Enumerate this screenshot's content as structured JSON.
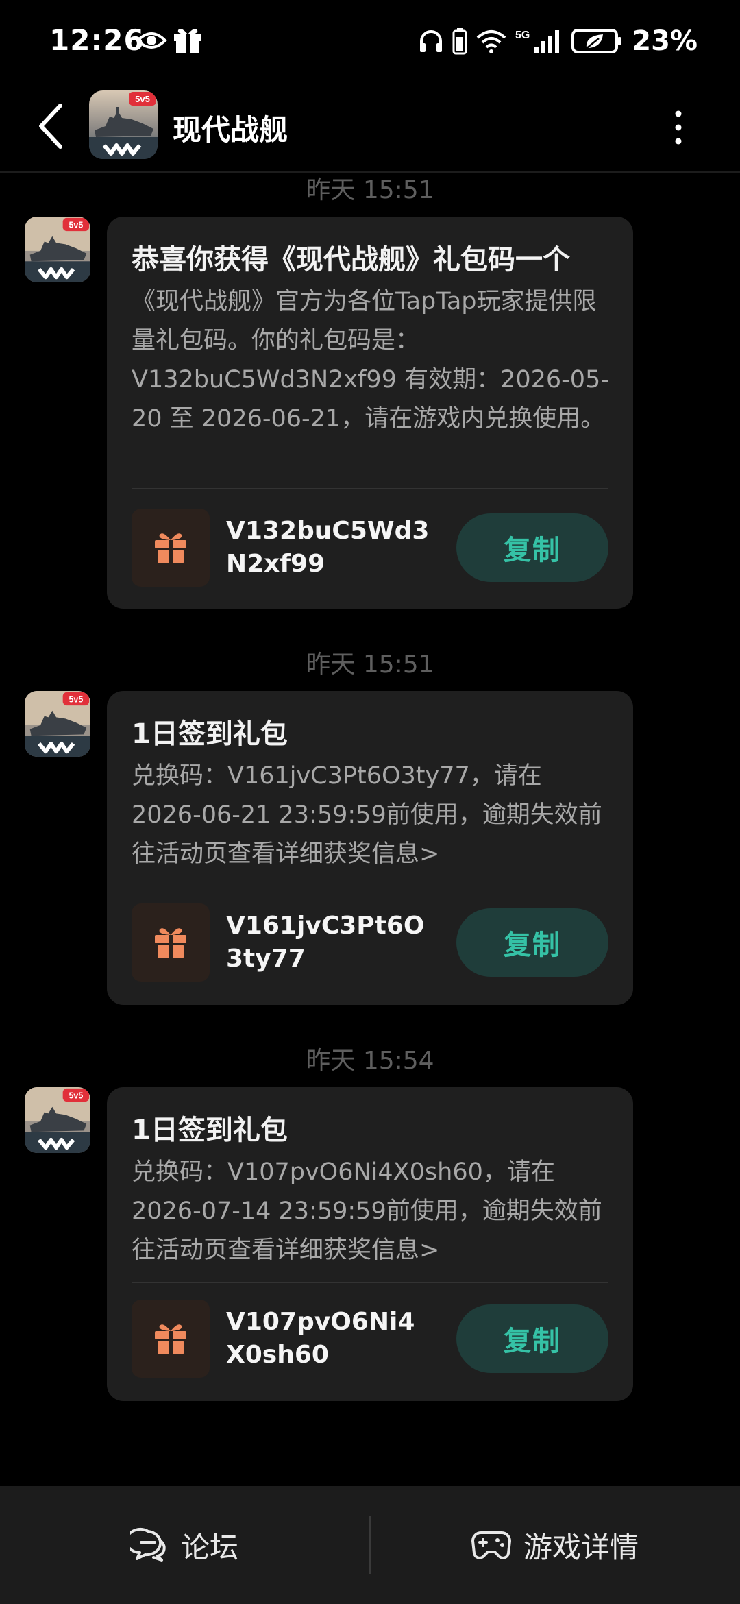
{
  "status_bar": {
    "time": "12:26",
    "network": "5G",
    "battery": "23%"
  },
  "header": {
    "title": "现代战舰",
    "app_badge": "5v5"
  },
  "messages": [
    {
      "time": "昨天  15:51",
      "title": "恭喜你获得《现代战舰》礼包码一个",
      "body": "《现代战舰》官方为各位TapTap玩家提供限量礼包码。你的礼包码是：V132buC5Wd3N2xf99 有效期：2026-05-20 至 2026-06-21，请在游戏内兑换使用。",
      "code": "V132buC5Wd3N2xf99",
      "copy_label": "复制"
    },
    {
      "time": "昨天  15:51",
      "title": "1日签到礼包",
      "body": "兑换码：V161jvC3Pt6O3ty77，请在2026-06-21 23:59:59前使用，逾期失效前往活动页查看详细获奖信息>",
      "code": "V161jvC3Pt6O3ty77",
      "copy_label": "复制"
    },
    {
      "time": "昨天  15:54",
      "title": "1日签到礼包",
      "body": "兑换码：V107pvO6Ni4X0sh60，请在2026-07-14 23:59:59前使用，逾期失效前往活动页查看详细获奖信息>",
      "code": "V107pvO6Ni4X0sh60",
      "copy_label": "复制"
    }
  ],
  "bottom_bar": {
    "forum_label": "论坛",
    "game_detail_label": "游戏详情"
  },
  "colors": {
    "background": "#000000",
    "bubble": "#1f1f1f",
    "copy_button_bg": "#1f3d3a",
    "copy_button_text": "#35c2a6",
    "gift_icon": "#f08a5d"
  }
}
